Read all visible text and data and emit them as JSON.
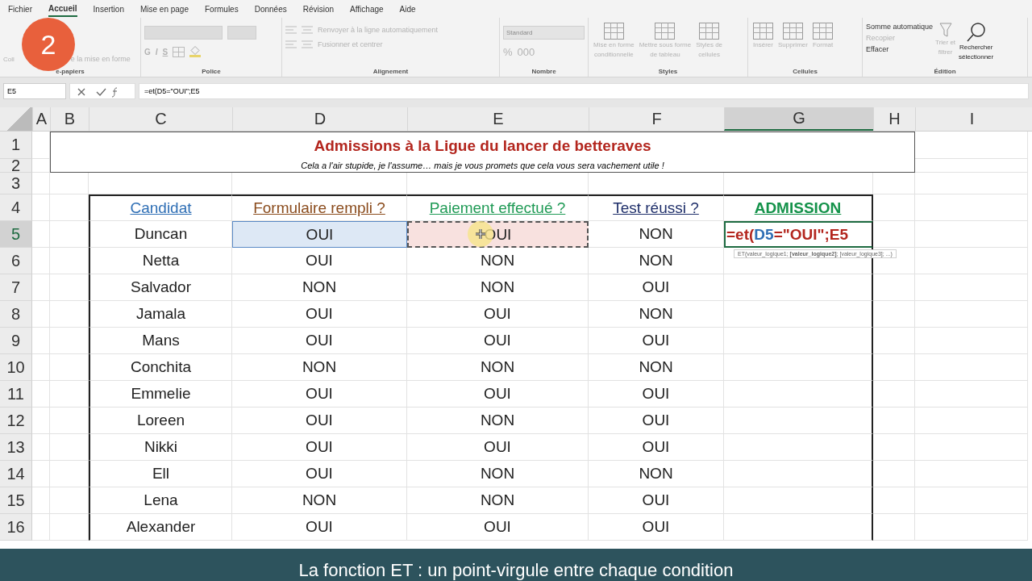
{
  "menu_tabs": [
    {
      "label": "Fichier",
      "selected": false
    },
    {
      "label": "Accueil",
      "selected": true
    },
    {
      "label": "Insertion",
      "selected": false
    },
    {
      "label": "Mise en page",
      "selected": false
    },
    {
      "label": "Formules",
      "selected": false
    },
    {
      "label": "Données",
      "selected": false
    },
    {
      "label": "Révision",
      "selected": false
    },
    {
      "label": "Affichage",
      "selected": false
    },
    {
      "label": "Aide",
      "selected": false
    }
  ],
  "ribbon": [
    {
      "name": "e-papiers",
      "kind": "clipboard",
      "items": [
        {
          "lines": [
            "Coll"
          ],
          "disabled": true
        },
        {
          "lines": [
            "e la mise en forme"
          ],
          "disabled": true
        }
      ]
    },
    {
      "name": "Police",
      "kind": "font",
      "items": [
        {
          "lines": [
            "G"
          ],
          "disabled": true
        },
        {
          "lines": [
            "I"
          ],
          "disabled": true
        },
        {
          "lines": [
            "S"
          ],
          "disabled": true
        }
      ]
    },
    {
      "name": "Alignement",
      "kind": "align",
      "items": [
        {
          "lines": [
            "Renvoyer à la ligne automatiquement"
          ],
          "disabled": true
        },
        {
          "lines": [
            "Fusionner et centrer"
          ],
          "disabled": true
        }
      ]
    },
    {
      "name": "Nombre",
      "kind": "number",
      "items": [
        {
          "lines": [
            "Standard"
          ],
          "disabled": true
        },
        {
          "lines": [
            "%"
          ],
          "disabled": true
        },
        {
          "lines": [
            "000"
          ],
          "disabled": true
        }
      ]
    },
    {
      "name": "Styles",
      "kind": "large",
      "items": [
        {
          "lines": [
            "Mise en forme",
            "conditionnelle"
          ],
          "disabled": true
        },
        {
          "lines": [
            "Mettre sous forme",
            "de tableau"
          ],
          "disabled": true
        },
        {
          "lines": [
            "Styles de",
            "cellules"
          ],
          "disabled": true
        }
      ]
    },
    {
      "name": "Cellules",
      "kind": "large",
      "items": [
        {
          "lines": [
            "Insérer"
          ],
          "disabled": true
        },
        {
          "lines": [
            "Supprimer"
          ],
          "disabled": true
        },
        {
          "lines": [
            "Format"
          ],
          "disabled": true
        }
      ]
    },
    {
      "name": "Édition",
      "kind": "edit",
      "items": [
        {
          "lines": [
            "Somme automatique"
          ],
          "disabled": false
        },
        {
          "lines": [
            "Recopier"
          ],
          "disabled": true
        },
        {
          "lines": [
            "Effacer"
          ],
          "disabled": false
        },
        {
          "lines": [
            "Trier et",
            "filtrer"
          ],
          "disabled": true
        },
        {
          "lines": [
            "Rechercher",
            "sélectionner"
          ],
          "disabled": false
        }
      ]
    }
  ],
  "step_badge": "2",
  "name_box": "E5",
  "formula": "=et(D5=\"OUI\";E5",
  "columns": [
    {
      "letter": "A",
      "selected": false
    },
    {
      "letter": "B",
      "selected": false
    },
    {
      "letter": "C",
      "selected": false
    },
    {
      "letter": "D",
      "selected": false
    },
    {
      "letter": "E",
      "selected": false
    },
    {
      "letter": "F",
      "selected": false
    },
    {
      "letter": "G",
      "selected": true
    },
    {
      "letter": "H",
      "selected": false
    },
    {
      "letter": "I",
      "selected": false
    }
  ],
  "title": "Admissions à la Ligue du lancer de betteraves",
  "subtitle": "Cela a l'air stupide, je l'assume… mais je vous promets que cela vous sera vachement utile !",
  "headers": [
    {
      "text": "Candidat",
      "color": "#2f6fb5"
    },
    {
      "text": "Formulaire rempli ?",
      "color": "#8a4b1c"
    },
    {
      "text": "Paiement effectué ?",
      "color": "#1f9a55"
    },
    {
      "text": "Test réussi ?",
      "color": "#1f2f6a"
    },
    {
      "text": "ADMISSION",
      "color": "#14924a"
    }
  ],
  "rows": [
    {
      "number": "1",
      "selected": false,
      "kind": "title"
    },
    {
      "number": "2",
      "selected": false,
      "kind": "subtitle"
    },
    {
      "number": "3",
      "selected": false,
      "kind": "empty"
    },
    {
      "number": "4",
      "selected": false,
      "kind": "header"
    },
    {
      "number": "5",
      "selected": true,
      "kind": "data",
      "name": "Duncan",
      "cells": [
        {
          "text": "OUI",
          "selected": true,
          "referenced": false
        },
        {
          "text": "OUI",
          "selected": false,
          "referenced": true
        },
        {
          "text": "NON",
          "selected": false,
          "referenced": false
        }
      ],
      "editing": true
    },
    {
      "number": "6",
      "selected": false,
      "kind": "data",
      "name": "Netta",
      "cells": [
        {
          "text": "OUI",
          "selected": false,
          "referenced": false
        },
        {
          "text": "NON",
          "selected": false,
          "referenced": false
        },
        {
          "text": "NON",
          "selected": false,
          "referenced": false
        }
      ],
      "editing": false
    },
    {
      "number": "7",
      "selected": false,
      "kind": "data",
      "name": "Salvador",
      "cells": [
        {
          "text": "NON",
          "selected": false,
          "referenced": false
        },
        {
          "text": "NON",
          "selected": false,
          "referenced": false
        },
        {
          "text": "OUI",
          "selected": false,
          "referenced": false
        }
      ],
      "editing": false
    },
    {
      "number": "8",
      "selected": false,
      "kind": "data",
      "name": "Jamala",
      "cells": [
        {
          "text": "OUI",
          "selected": false,
          "referenced": false
        },
        {
          "text": "OUI",
          "selected": false,
          "referenced": false
        },
        {
          "text": "NON",
          "selected": false,
          "referenced": false
        }
      ],
      "editing": false
    },
    {
      "number": "9",
      "selected": false,
      "kind": "data",
      "name": "Mans",
      "cells": [
        {
          "text": "OUI",
          "selected": false,
          "referenced": false
        },
        {
          "text": "OUI",
          "selected": false,
          "referenced": false
        },
        {
          "text": "OUI",
          "selected": false,
          "referenced": false
        }
      ],
      "editing": false
    },
    {
      "number": "10",
      "selected": false,
      "kind": "data",
      "name": "Conchita",
      "cells": [
        {
          "text": "NON",
          "selected": false,
          "referenced": false
        },
        {
          "text": "NON",
          "selected": false,
          "referenced": false
        },
        {
          "text": "NON",
          "selected": false,
          "referenced": false
        }
      ],
      "editing": false
    },
    {
      "number": "11",
      "selected": false,
      "kind": "data",
      "name": "Emmelie",
      "cells": [
        {
          "text": "OUI",
          "selected": false,
          "referenced": false
        },
        {
          "text": "OUI",
          "selected": false,
          "referenced": false
        },
        {
          "text": "OUI",
          "selected": false,
          "referenced": false
        }
      ],
      "editing": false
    },
    {
      "number": "12",
      "selected": false,
      "kind": "data",
      "name": "Loreen",
      "cells": [
        {
          "text": "OUI",
          "selected": false,
          "referenced": false
        },
        {
          "text": "NON",
          "selected": false,
          "referenced": false
        },
        {
          "text": "OUI",
          "selected": false,
          "referenced": false
        }
      ],
      "editing": false
    },
    {
      "number": "13",
      "selected": false,
      "kind": "data",
      "name": "Nikki",
      "cells": [
        {
          "text": "OUI",
          "selected": false,
          "referenced": false
        },
        {
          "text": "OUI",
          "selected": false,
          "referenced": false
        },
        {
          "text": "OUI",
          "selected": false,
          "referenced": false
        }
      ],
      "editing": false
    },
    {
      "number": "14",
      "selected": false,
      "kind": "data",
      "name": "Ell",
      "cells": [
        {
          "text": "OUI",
          "selected": false,
          "referenced": false
        },
        {
          "text": "NON",
          "selected": false,
          "referenced": false
        },
        {
          "text": "NON",
          "selected": false,
          "referenced": false
        }
      ],
      "editing": false
    },
    {
      "number": "15",
      "selected": false,
      "kind": "data",
      "name": "Lena",
      "cells": [
        {
          "text": "NON",
          "selected": false,
          "referenced": false
        },
        {
          "text": "NON",
          "selected": false,
          "referenced": false
        },
        {
          "text": "OUI",
          "selected": false,
          "referenced": false
        }
      ],
      "editing": false
    },
    {
      "number": "16",
      "selected": false,
      "kind": "data",
      "name": "Alexander",
      "cells": [
        {
          "text": "OUI",
          "selected": false,
          "referenced": false
        },
        {
          "text": "OUI",
          "selected": false,
          "referenced": false
        },
        {
          "text": "OUI",
          "selected": false,
          "referenced": false
        }
      ],
      "editing": false
    }
  ],
  "edit_text": [
    {
      "text": "=et(",
      "color": "#b3261e"
    },
    {
      "text": "D5",
      "color": "#2f6fb5"
    },
    {
      "text": "=\"OUI\";E5",
      "color": "#b3261e"
    }
  ],
  "tooltip": "ET(valeur_logique1; **[valeur_logique2]**; [valeur_logique3]; ...)",
  "caption": "La fonction ET : un point-virgule entre chaque condition"
}
